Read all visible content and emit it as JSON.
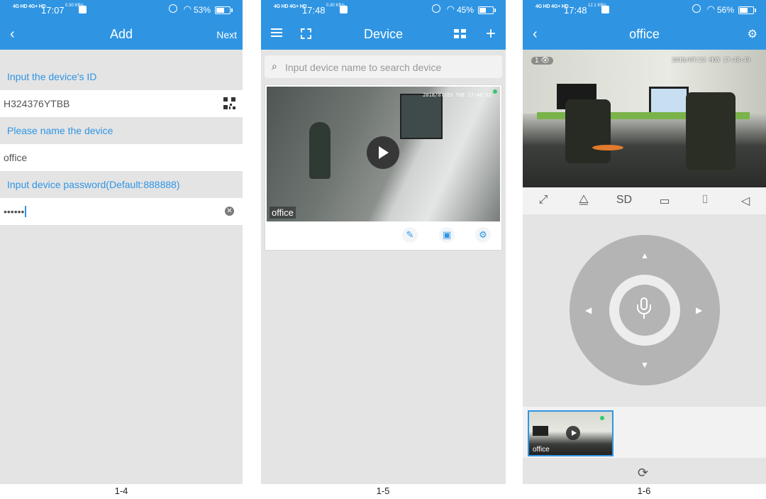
{
  "panel1": {
    "status": {
      "net": "4G HD 4G+ HD",
      "time": "17:07",
      "speed": "0.30 KB/s",
      "battery": "53%",
      "battery_level": 0.53
    },
    "back_icon": "chevron-left-icon",
    "title": "Add",
    "next_label": "Next",
    "id_label": "Input the device's ID",
    "id_value": "H324376YTBB",
    "name_label": "Please name the device",
    "name_value": "office",
    "password_label": "Input device password(Default:888888)",
    "password_value": "••••••"
  },
  "panel2": {
    "status": {
      "net": "4G HD 4G+ HD",
      "time": "17:48",
      "speed": "0.30 KB/s",
      "battery": "45%",
      "battery_level": 0.45
    },
    "title": "Device",
    "search_placeholder": "Input device name to search device",
    "device": {
      "name": "office",
      "timestamp": "2018/07/23  TUE 17:48:32"
    },
    "icons": [
      "menu-icon",
      "scan-icon",
      "grid-view-icon",
      "plus-icon",
      "edit-icon",
      "playback-icon",
      "settings-icon"
    ]
  },
  "panel3": {
    "status": {
      "net": "4G HD 4G+ HD",
      "time": "17:48",
      "speed": "12.1 KB/s",
      "battery": "56%",
      "battery_level": 0.56
    },
    "title": "office",
    "timestamp": "2018/07/23  MON 17:48:49",
    "viewer_count": "1",
    "quality_label": "SD",
    "thumbnail_name": "office"
  },
  "captions": [
    "1-4",
    "1-5",
    "1-6"
  ],
  "colors": {
    "accent": "#2f95e3",
    "background": "#e4e4e4",
    "online": "#35c76b"
  }
}
